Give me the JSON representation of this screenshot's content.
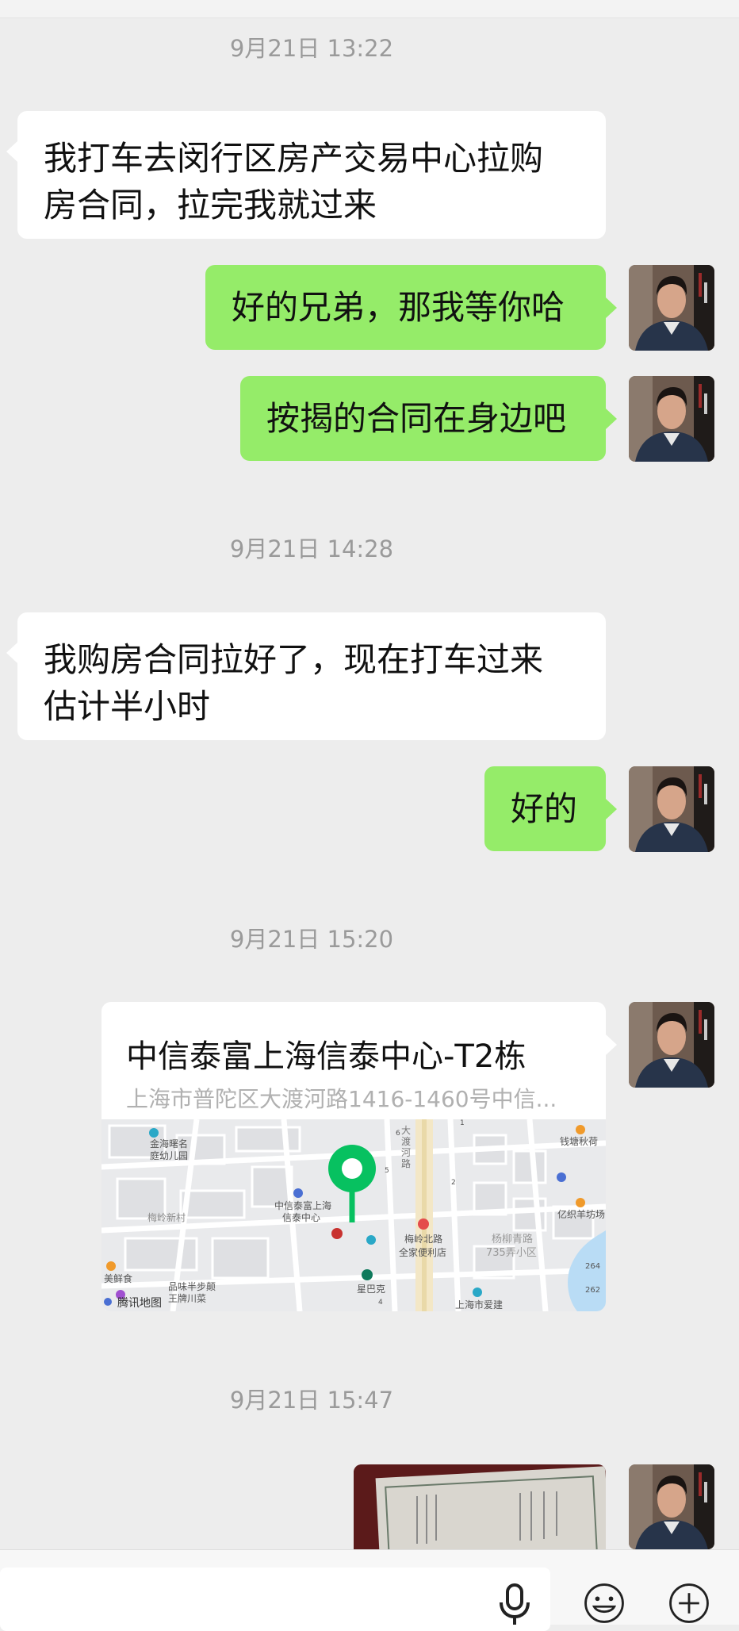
{
  "timestamps": [
    "9月21日 13:22",
    "9月21日 14:28",
    "9月21日 15:20",
    "9月21日 15:47"
  ],
  "messages": {
    "m1": "我打车去闵行区房产交易中心拉购",
    "m1b": "房合同，拉完我就过来",
    "m2": "好的兄弟，那我等你哈",
    "m3": "按揭的合同在身边吧",
    "m4": "我购房合同拉好了，现在打车过来",
    "m4b": "估计半小时",
    "m5": "好的"
  },
  "location": {
    "title": "中信泰富上海信泰中心-T2栋",
    "address": "上海市普陀区大渡河路1416-1460号中信...",
    "map_labels": {
      "kindergarten1": "金海曙名",
      "kindergarten2": "庭幼儿园",
      "village": "梅岭新村",
      "center1": "中信泰富上海",
      "center2": "信泰中心",
      "road1": "大",
      "road2": "渡",
      "road3": "河",
      "road4": "路",
      "station": "梅岭北路",
      "store": "全家便利店",
      "community1": "杨柳青路",
      "community2": "735弄小区",
      "qiantang": "钱塘秋荷",
      "yiyi": "亿织羊坊场",
      "starbucks": "星巴克",
      "meirishi": "美鲜食",
      "pinwei1": "品味半步颠",
      "pinwei2": "王牌川菜",
      "aijian": "上海市爱建",
      "brand": "腾讯地图",
      "n1": "6",
      "n2": "5",
      "n3": "2",
      "n4": "1",
      "n5": "4",
      "n6": "264",
      "n7": "262"
    }
  },
  "icons": {
    "mic": "microphone-icon",
    "emoji": "emoji-icon",
    "plus": "plus-icon"
  },
  "colors": {
    "outgoing_bubble": "#95ec69",
    "incoming_bubble": "#ffffff",
    "background": "#ededed",
    "pin": "#07c160"
  }
}
